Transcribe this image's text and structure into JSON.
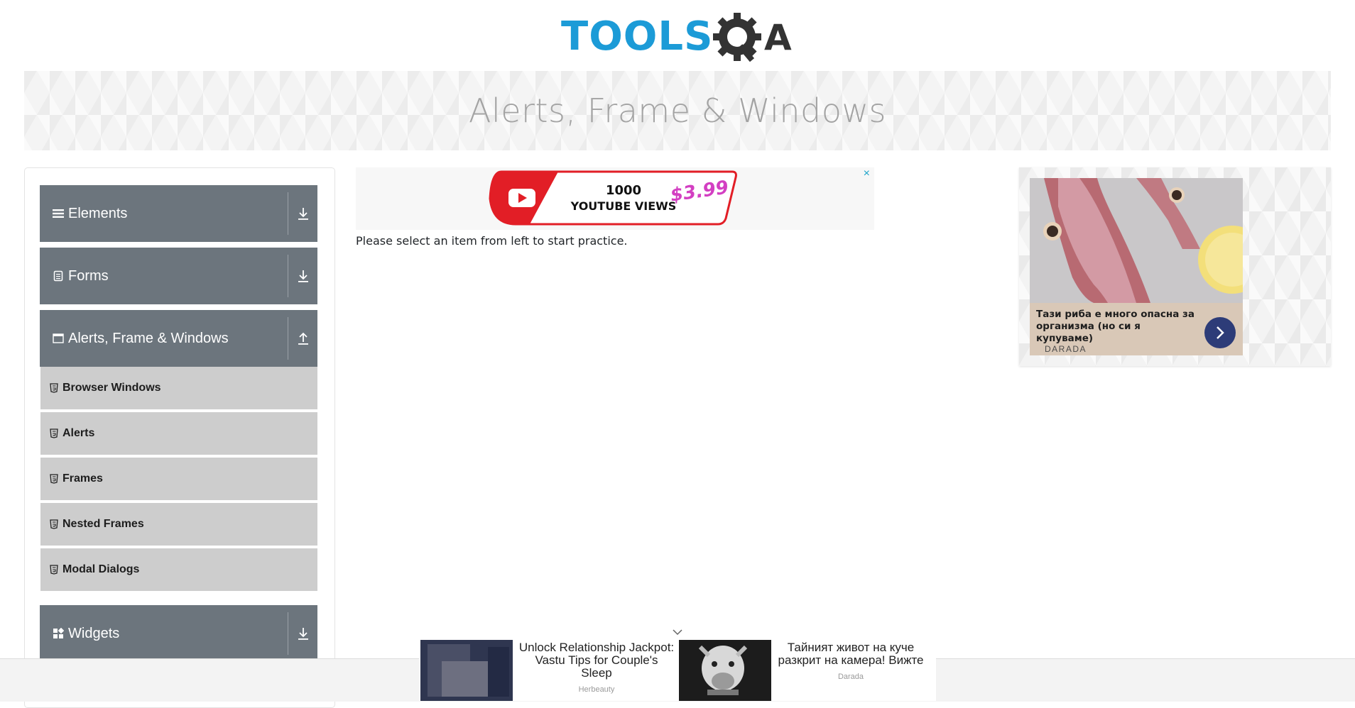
{
  "header": {
    "logo_text_left": "TOOLS",
    "logo_text_right": "QA"
  },
  "banner": {
    "title": "Alerts, Frame & Windows"
  },
  "sidebar": {
    "groups": [
      {
        "label": "Elements",
        "icon": "menu-icon",
        "expanded": false
      },
      {
        "label": "Forms",
        "icon": "form-icon",
        "expanded": false
      },
      {
        "label": "Alerts, Frame & Windows",
        "icon": "window-icon",
        "expanded": true
      },
      {
        "label": "Widgets",
        "icon": "widgets-icon",
        "expanded": false
      }
    ],
    "items": [
      {
        "label": "Browser Windows"
      },
      {
        "label": "Alerts"
      },
      {
        "label": "Frames"
      },
      {
        "label": "Nested Frames"
      },
      {
        "label": "Modal Dialogs"
      }
    ]
  },
  "main": {
    "instruction": "Please select an item from left to start practice."
  },
  "top_ad": {
    "line1": "1000",
    "line2": "YOUTUBE VIEWS",
    "price": "$3.99",
    "close": "×"
  },
  "right_ad": {
    "caption": "Тази риба е много опасна за организма (но си я купуваме)",
    "brand": "DARADA"
  },
  "bottom_ad": {
    "items": [
      {
        "title": "Unlock Relationship Jackpot: Vastu Tips for Couple's Sleep",
        "source": "Herbeauty"
      },
      {
        "title": "Тайният живот на куче разкрит на камера! Вижте",
        "source": "Darada"
      }
    ]
  },
  "colors": {
    "accent": "#1c9bd7",
    "sidebar_header": "#6c757d",
    "sidebar_item": "#cdcdcd",
    "banner_text": "#a3a3a3"
  }
}
